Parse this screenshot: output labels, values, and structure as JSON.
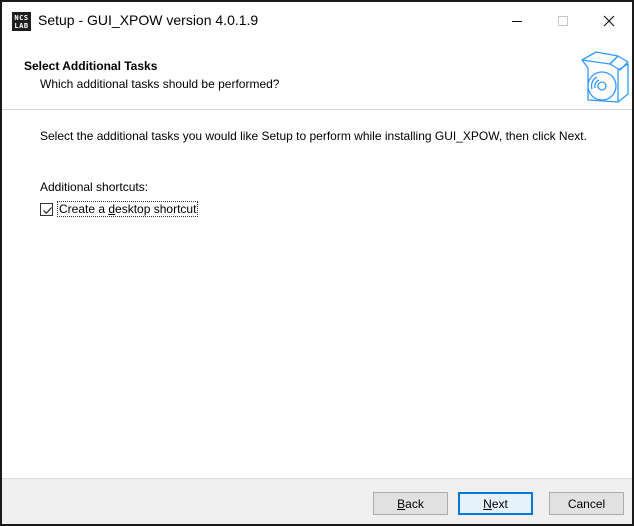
{
  "window": {
    "title": "Setup - GUI_XPOW version 4.0.1.9",
    "icon_text_top": "NCS",
    "icon_text_bottom": "LAB",
    "controls": {
      "minimize": "minimize-icon",
      "maximize": "maximize-icon",
      "close": "close-icon"
    }
  },
  "header": {
    "title": "Select Additional Tasks",
    "subtitle": "Which additional tasks should be performed?",
    "graphic": "setup-box-cd-icon"
  },
  "body": {
    "description": "Select the additional tasks you would like Setup to perform while installing GUI_XPOW, then click Next.",
    "shortcuts_label": "Additional shortcuts:",
    "desktop_shortcut": {
      "label_pre": "Create a ",
      "label_accel": "d",
      "label_post": "esktop shortcut",
      "checked": true
    }
  },
  "footer": {
    "back": {
      "accel": "B",
      "rest": "ack"
    },
    "next": {
      "accel": "N",
      "rest": "ext"
    },
    "cancel": "Cancel"
  },
  "colors": {
    "accent": "#0078d7",
    "footer_bg": "#f0f0f0",
    "graphic": "#3399ff"
  }
}
